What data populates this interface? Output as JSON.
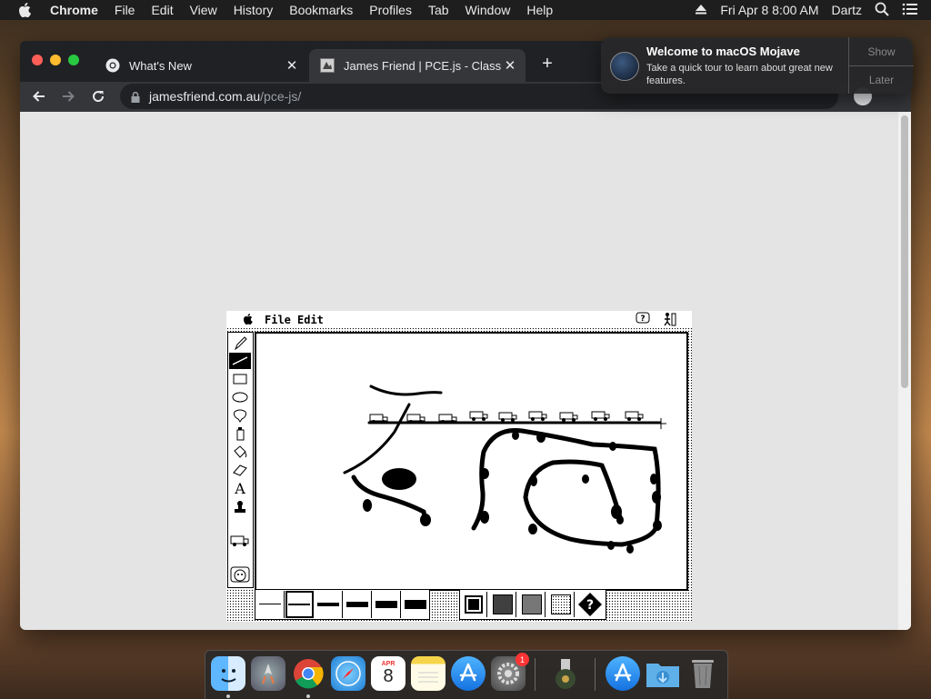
{
  "menubar": {
    "app_name": "Chrome",
    "items": [
      "File",
      "Edit",
      "View",
      "History",
      "Bookmarks",
      "Profiles",
      "Tab",
      "Window",
      "Help"
    ],
    "user": "Dartz",
    "clock": "Fri Apr 8  8:00 AM"
  },
  "browser": {
    "tabs": [
      {
        "title": "What's New",
        "active": false
      },
      {
        "title": "James Friend | PCE.js - Classic",
        "active": true
      }
    ],
    "url_host": "jamesfriend.com.au",
    "url_path": "/pce-js/"
  },
  "notification": {
    "title": "Welcome to macOS Mojave",
    "body": "Take a quick tour to learn about great new features.",
    "show_label": "Show",
    "later_label": "Later"
  },
  "emulator": {
    "menu": [
      "File",
      "Edit"
    ],
    "tools": [
      "pencil-tool",
      "line-tool",
      "rectangle-tool",
      "oval-tool",
      "lasso-tool",
      "spray-tool",
      "paint-bucket-tool",
      "eraser-tool",
      "text-tool",
      "stamp-tool"
    ],
    "help_mark": "?"
  },
  "dock": {
    "apps": [
      "Finder",
      "Launchpad",
      "Google Chrome",
      "Safari",
      "Calendar",
      "Notes",
      "App Store",
      "System Preferences",
      "Disk Image",
      "Applications",
      "Downloads",
      "Trash"
    ],
    "calendar_month": "APR",
    "calendar_day": "8",
    "system_prefs_badge": "1"
  },
  "colors": {
    "menubar_bg": "#1e1e1f",
    "tab_active": "#35363a",
    "chrome_dark": "#202124",
    "traffic_red": "#ff5f57",
    "traffic_yellow": "#febc2e",
    "traffic_green": "#28c840"
  }
}
